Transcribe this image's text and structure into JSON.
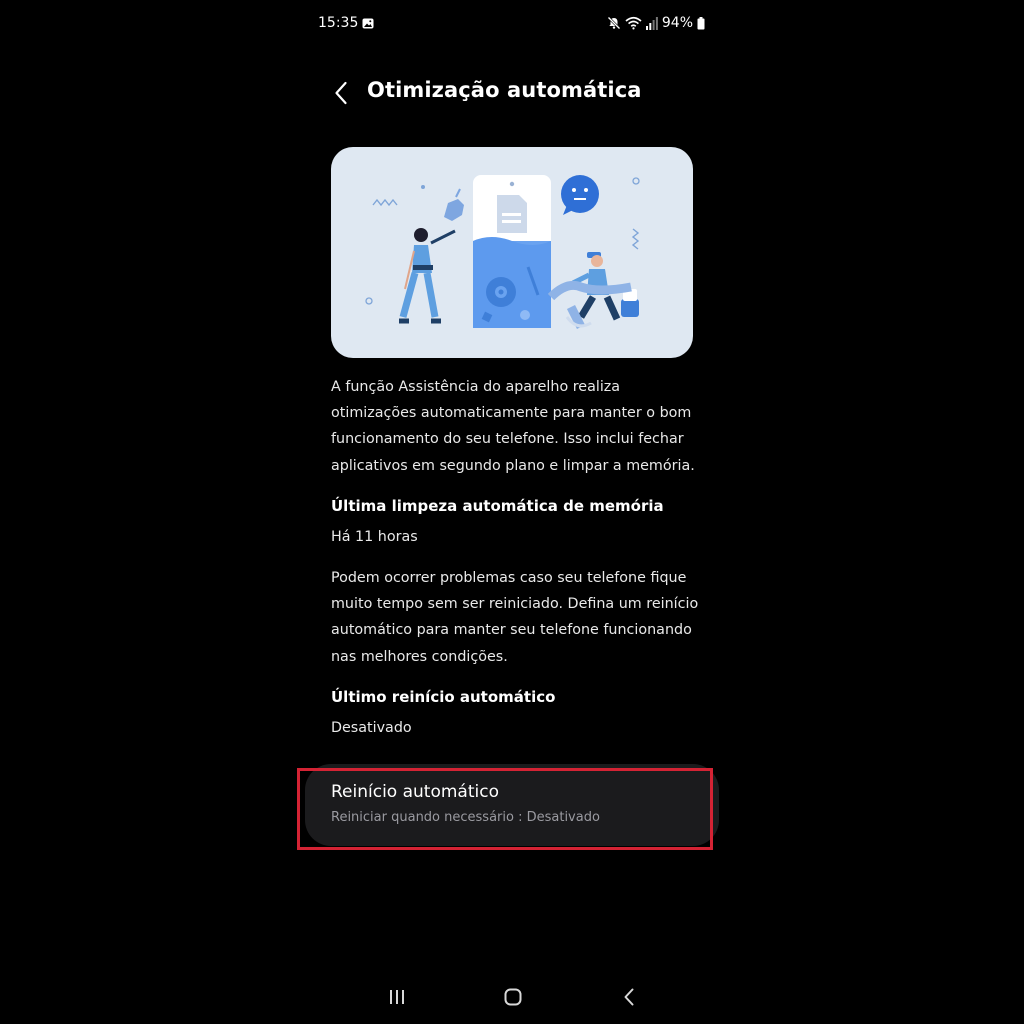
{
  "status_bar": {
    "time": "15:35",
    "battery": "94%"
  },
  "header": {
    "title": "Otimização automática"
  },
  "description": "A função Assistência do aparelho realiza otimizações automaticamente para manter o bom funcionamento do seu telefone. Isso inclui fechar aplicativos em segundo plano e limpar a memória.",
  "last_memory_clean": {
    "label": "Última limpeza automática de memória",
    "value": "Há 11 horas"
  },
  "restart_description": "Podem ocorrer problemas caso seu telefone fique muito tempo sem ser reiniciado. Defina um reinício automático para manter seu telefone funcionando nas melhores condições.",
  "last_restart": {
    "label": "Último reinício automático",
    "value": "Desativado"
  },
  "auto_restart": {
    "title": "Reinício automático",
    "subtitle": "Reiniciar quando necessário : Desativado"
  },
  "colors": {
    "background": "#000000",
    "card": "#1b1b1d",
    "highlight": "#d42334",
    "illustration_bg": "#dfe8f2"
  },
  "icons": [
    "gallery-icon",
    "mute-icon",
    "wifi-icon",
    "signal-icon",
    "battery-icon",
    "back-arrow-icon",
    "recents-icon",
    "home-icon",
    "nav-back-icon"
  ]
}
